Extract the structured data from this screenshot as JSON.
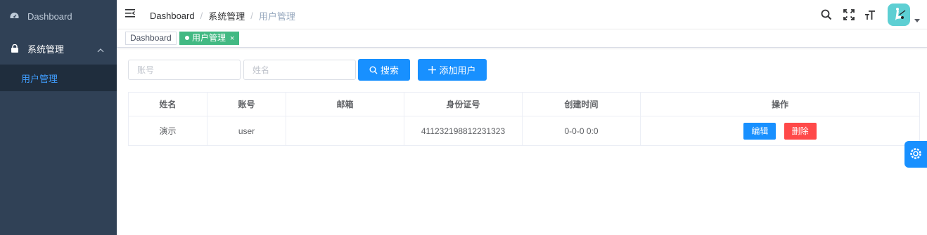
{
  "sidebar": {
    "items": [
      {
        "label": "Dashboard",
        "icon": "dashboard-icon"
      },
      {
        "label": "系统管理",
        "icon": "lock-icon"
      }
    ],
    "submenu": [
      {
        "label": "用户管理"
      }
    ]
  },
  "navbar": {
    "breadcrumb": [
      "Dashboard",
      "系统管理",
      "用户管理"
    ],
    "separator": "/",
    "icons": [
      "search-icon",
      "fullscreen-icon",
      "font-size-icon"
    ]
  },
  "tags": [
    {
      "label": "Dashboard"
    },
    {
      "label": "用户管理",
      "close": "×"
    }
  ],
  "filters": {
    "account_placeholder": "账号",
    "name_placeholder": "姓名",
    "search_label": "搜索",
    "add_label": "添加用户"
  },
  "table": {
    "headers": [
      "姓名",
      "账号",
      "邮箱",
      "身份证号",
      "创建时间",
      "操作"
    ],
    "rows": [
      {
        "name": "演示",
        "account": "user",
        "email": "",
        "id_number": "411232198812231323",
        "created": "0-0-0 0:0",
        "edit_label": "编辑",
        "delete_label": "删除"
      }
    ]
  },
  "colors": {
    "sidebar_bg": "#304156",
    "accent": "#1890ff",
    "tag_active": "#42b983",
    "danger": "#ff4949"
  }
}
